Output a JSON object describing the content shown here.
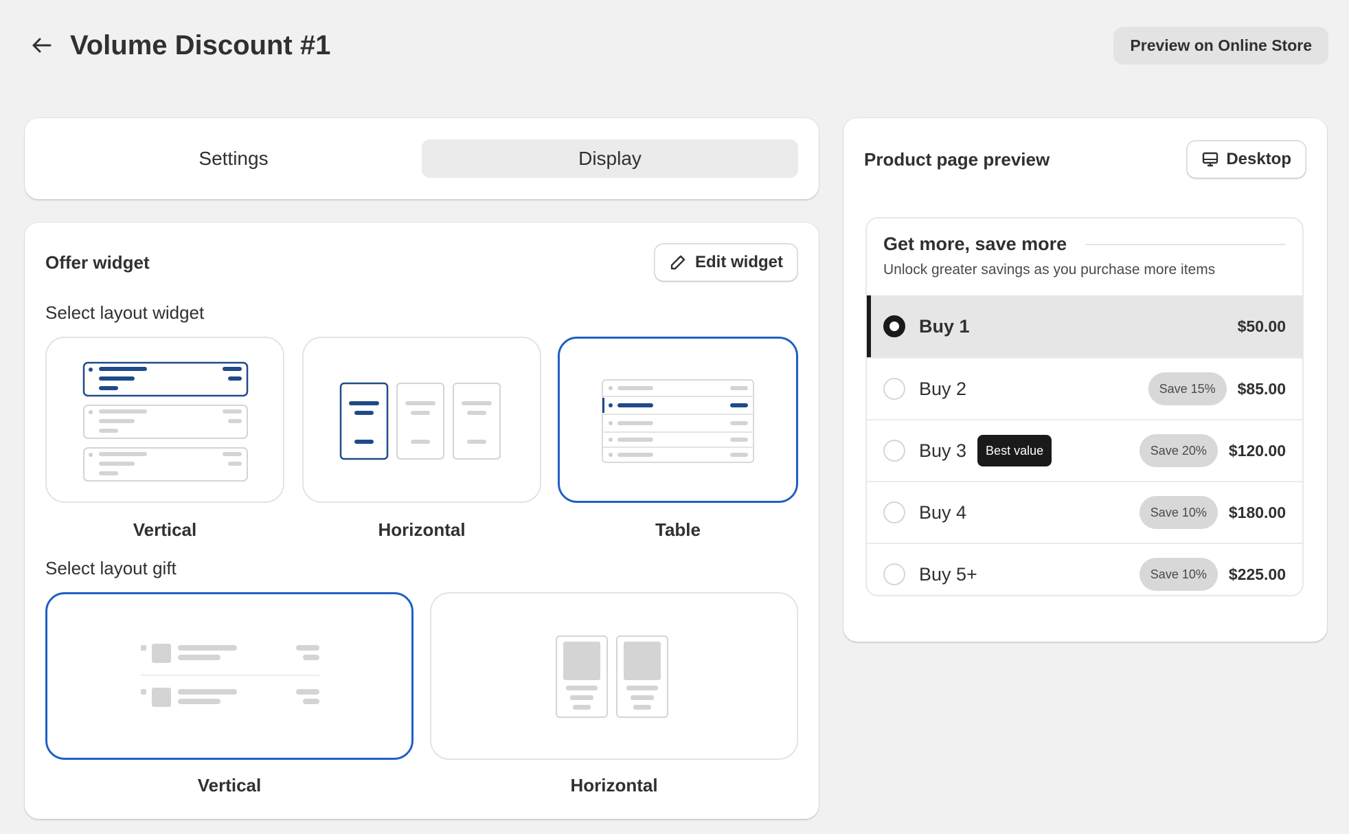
{
  "header": {
    "title": "Volume Discount #1",
    "back_icon": "arrow-left-icon",
    "preview_store_label": "Preview on Online Store"
  },
  "tabs": [
    {
      "label": "Settings",
      "active": false
    },
    {
      "label": "Display",
      "active": true
    }
  ],
  "widget": {
    "title": "Offer widget",
    "edit_label": "Edit widget",
    "edit_icon": "pencil-icon",
    "layout_widget_label": "Select layout widget",
    "layout_widget_options": [
      {
        "label": "Vertical",
        "selected": false
      },
      {
        "label": "Horizontal",
        "selected": false
      },
      {
        "label": "Table",
        "selected": true
      }
    ],
    "layout_gift_label": "Select layout gift",
    "layout_gift_options": [
      {
        "label": "Vertical",
        "selected": true
      },
      {
        "label": "Horizontal",
        "selected": false
      }
    ]
  },
  "preview": {
    "title": "Product page preview",
    "device_label": "Desktop",
    "device_icon": "monitor-icon",
    "offer": {
      "title": "Get more, save more",
      "subtitle": "Unlock greater savings as you purchase more items",
      "tiers": [
        {
          "label": "Buy 1",
          "badge": "",
          "save": "",
          "price": "$50.00",
          "selected": true
        },
        {
          "label": "Buy 2",
          "badge": "",
          "save": "Save 15%",
          "price": "$85.00",
          "selected": false
        },
        {
          "label": "Buy 3",
          "badge": "Best value",
          "save": "Save 20%",
          "price": "$120.00",
          "selected": false
        },
        {
          "label": "Buy 4",
          "badge": "",
          "save": "Save 10%",
          "price": "$180.00",
          "selected": false
        },
        {
          "label": "Buy 5+",
          "badge": "",
          "save": "Save 10%",
          "price": "$225.00",
          "selected": false
        }
      ]
    }
  },
  "colors": {
    "accent": "#1f5fc4",
    "background": "#f1f1f1",
    "dark": "#1a1a1a"
  }
}
